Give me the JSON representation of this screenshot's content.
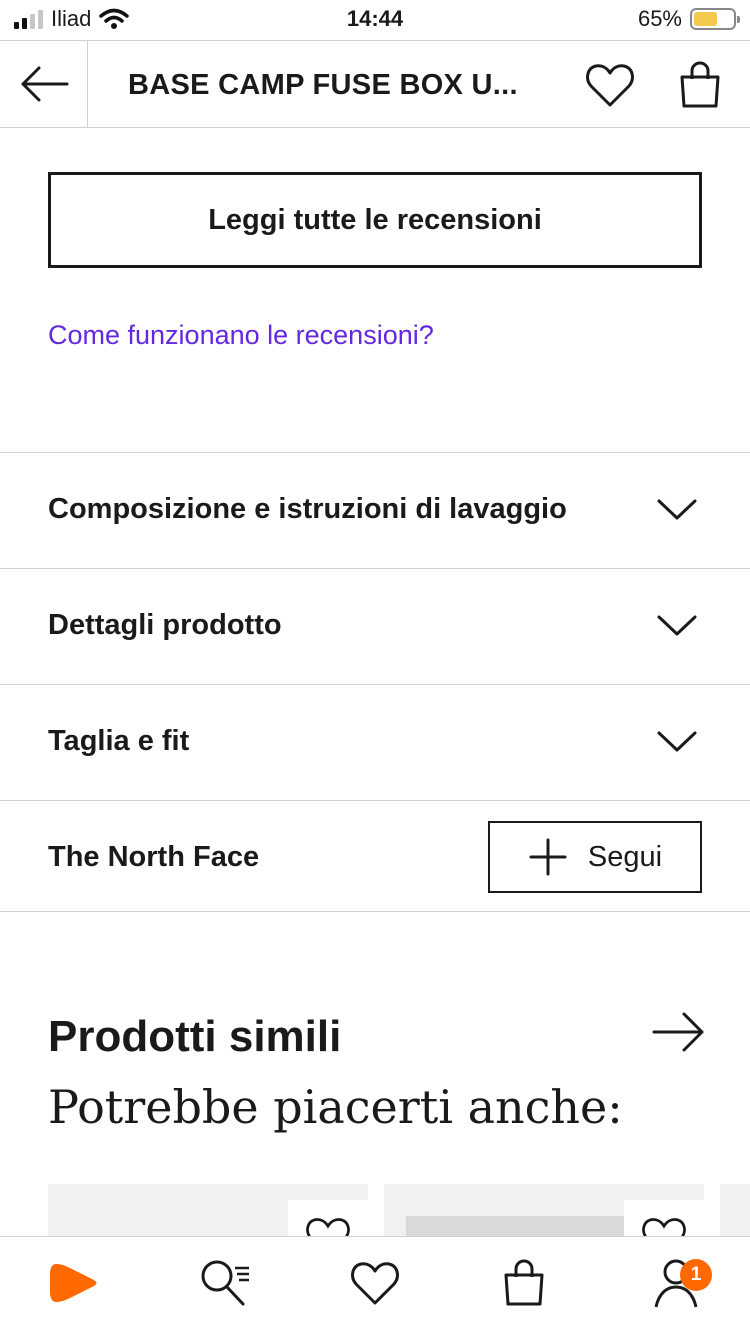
{
  "status_bar": {
    "carrier": "Iliad",
    "time": "14:44",
    "battery": "65%"
  },
  "header": {
    "title": "BASE CAMP FUSE BOX U..."
  },
  "reviews": {
    "read_all_label": "Leggi tutte le recensioni",
    "how_it_works_link": "Come funzionano le recensioni?"
  },
  "sections": [
    {
      "label": "Composizione e istruzioni di lavaggio"
    },
    {
      "label": "Dettagli prodotto"
    },
    {
      "label": "Taglia e fit"
    }
  ],
  "brand": {
    "name": "The North Face",
    "follow_label": "Segui"
  },
  "similar": {
    "title": "Prodotti simili",
    "subtitle": "Potrebbe piacerti anche:"
  },
  "tab_bar": {
    "profile_badge": "1"
  },
  "colors": {
    "accent": "#ff6900",
    "link": "#6328e0",
    "text": "#1a1a1a"
  }
}
